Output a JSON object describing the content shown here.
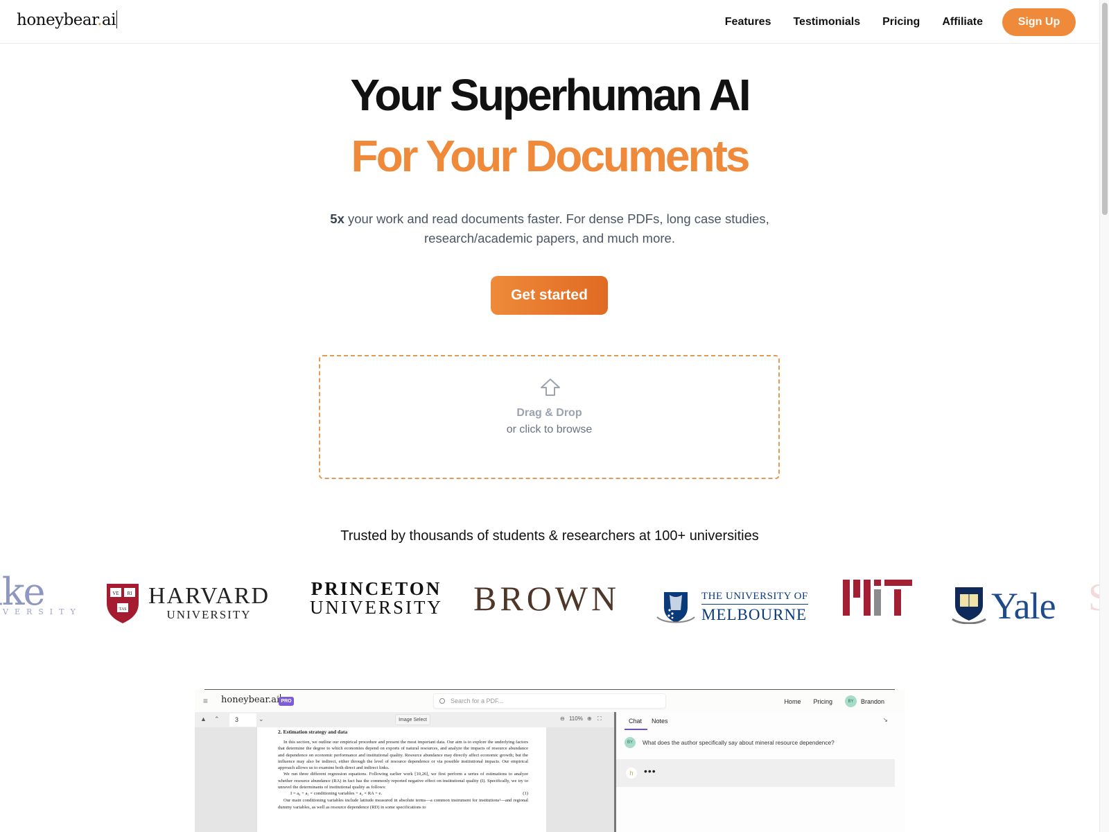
{
  "header": {
    "logo_text": "honeybear",
    "logo_dot": ".",
    "logo_suffix": "ai",
    "nav": [
      {
        "label": "Features"
      },
      {
        "label": "Testimonials"
      },
      {
        "label": "Pricing"
      },
      {
        "label": "Affiliate"
      }
    ],
    "signup_label": "Sign Up"
  },
  "hero": {
    "title_line1": "Your Superhuman AI",
    "title_line2": "For Your Documents",
    "subtitle_bold": "5x",
    "subtitle_line1": " your work and read documents faster. For dense PDFs, long case studies,",
    "subtitle_line2": "research/academic papers, and much more.",
    "cta_label": "Get started"
  },
  "dropzone": {
    "icon": "upload-arrow-icon",
    "title": "Drag & Drop",
    "subtitle": "or click to browse"
  },
  "trusted": {
    "heading": "Trusted by thousands of students & researchers at 100+ universities",
    "universities": [
      {
        "name": "Duke University",
        "text": "Duke",
        "sub": "UNIVERSITY",
        "visible_text": "uke",
        "visible_sub": "VERSITY"
      },
      {
        "name": "Harvard University",
        "line1": "HARVARD",
        "line2": "UNIVERSITY",
        "shield_text": [
          "VE",
          "RI",
          "TAS"
        ]
      },
      {
        "name": "Princeton University",
        "line1": "PRINCETON",
        "line2": "UNIVERSITY"
      },
      {
        "name": "Brown",
        "line1": "BROWN"
      },
      {
        "name": "The University of Melbourne",
        "line1": "THE UNIVERSITY OF",
        "line2": "MELBOURNE"
      },
      {
        "name": "MIT"
      },
      {
        "name": "Yale",
        "line1": "Yale"
      },
      {
        "name": "partial-logo",
        "line1": "S"
      }
    ]
  },
  "colors": {
    "accent": "#ee8a3a",
    "accent_dark": "#e06a22",
    "pro_badge": "#7c5cd6",
    "avatar": "#a7dcc9"
  },
  "preview": {
    "logo": "honeybear.ai",
    "badge": "PRO",
    "search_placeholder": "Search for a PDF...",
    "nav": [
      {
        "label": "Home"
      },
      {
        "label": "Pricing"
      }
    ],
    "user_initials": "BY",
    "user_name": "Brandon",
    "page_number": "3",
    "image_select_label": "Image Select",
    "zoom_level": "110%",
    "tabs": [
      {
        "label": "Chat",
        "active": true
      },
      {
        "label": "Notes",
        "active": false
      }
    ],
    "chat_question": "What does the author specifically say about mineral resource dependence?",
    "bot_initial": "h",
    "typing": "•••",
    "doc": {
      "heading": "2.  Estimation strategy and data",
      "para1": "In this section, we outline our empirical procedure and present the most important data. Our aim is to explore the underlying factors that determine the degree to which economies depend on exports of natural resources, and analyze the impacts of resource abundance and dependence on economic performance and institutional quality. Resource abundance may directly affect economic growth; but the influence may also be indirect, either through the level of resource dependence or via possible institutional impacts. Our empirical approach allows us to examine both direct and indirect links.",
      "para2": "We run three different regression equations. Following earlier work [10,26], we first perform a series of estimations to analyze whether resource abundance (RA) in fact has the commonly reported negative effect on institutional quality (I). Specifically, we try to unravel the determinants of institutional quality as follows:",
      "equation": "I = a₀ + a₁ × conditioning variables + a₂ × RA + e.",
      "equation_number": "(1)",
      "para3": "Our main conditioning variables include latitude measured in absolute terms—a common instrument for institutions¹—and regional dummy variables, as well as resource dependence (RD) in some specifications to"
    }
  }
}
